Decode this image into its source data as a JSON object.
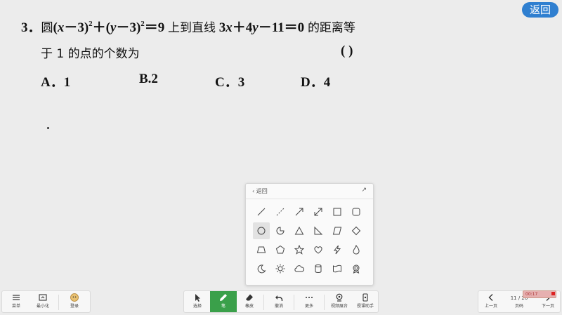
{
  "header": {
    "back_label": "返回"
  },
  "question": {
    "number": "3．",
    "line2_text": "于 1 的点的个数为",
    "paren": "(      )",
    "options": [
      "A．1",
      "B.2",
      "C．3",
      "D．4"
    ]
  },
  "panel": {
    "back_label": "返回"
  },
  "toolbar": {
    "left": [
      {
        "label": "菜单",
        "icon": "menu-icon"
      },
      {
        "label": "最小化",
        "icon": "minimize-icon"
      },
      {
        "label": "登录",
        "icon": "avatar-icon"
      }
    ],
    "center": [
      {
        "label": "选择",
        "icon": "cursor-icon"
      },
      {
        "label": "笔",
        "icon": "pen-icon"
      },
      {
        "label": "橡皮",
        "icon": "eraser-icon"
      },
      {
        "label": "撤消",
        "icon": "undo-icon"
      },
      {
        "label": "更多",
        "icon": "more-icon"
      },
      {
        "label": "视频展台",
        "icon": "camera-icon"
      },
      {
        "label": "授课助手",
        "icon": "phone-icon"
      }
    ],
    "right": {
      "prev_label": "上一页",
      "page": "11 / 20",
      "page_label": "页码",
      "next_label": "下一页"
    },
    "timer": "00:17"
  },
  "colors": {
    "accent": "#2f7fd0",
    "active_tool": "#3aa04a"
  }
}
